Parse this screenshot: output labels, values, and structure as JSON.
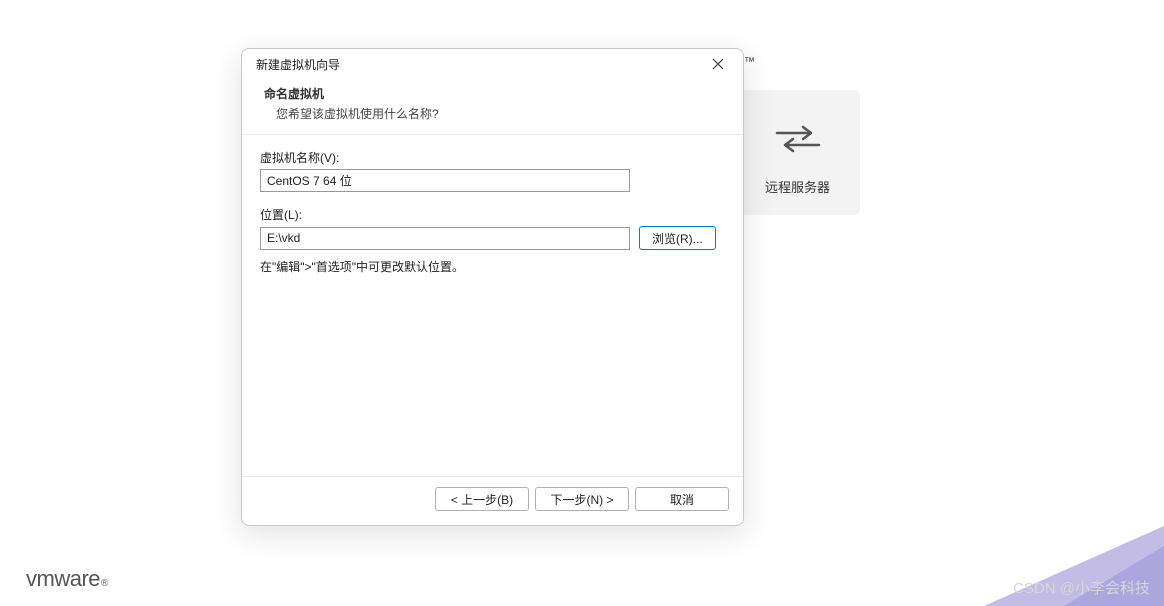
{
  "trademark_symbol": "™",
  "background_card": {
    "label": "远程服务器"
  },
  "dialog": {
    "title": "新建虚拟机向导",
    "heading": "命名虚拟机",
    "subheading": "您希望该虚拟机使用什么名称?",
    "vm_name_label": "虚拟机名称(V):",
    "vm_name_value": "CentOS 7 64 位",
    "location_label": "位置(L):",
    "location_value": "E:\\vkd",
    "browse_btn": "浏览(R)...",
    "hint": "在\"编辑\">\"首选项\"中可更改默认位置。",
    "back_btn": "< 上一步(B)",
    "next_btn": "下一步(N) >",
    "cancel_btn": "取消"
  },
  "logo_text": "vmware",
  "logo_reg": "®",
  "watermark": "CSDN @小李会科技"
}
